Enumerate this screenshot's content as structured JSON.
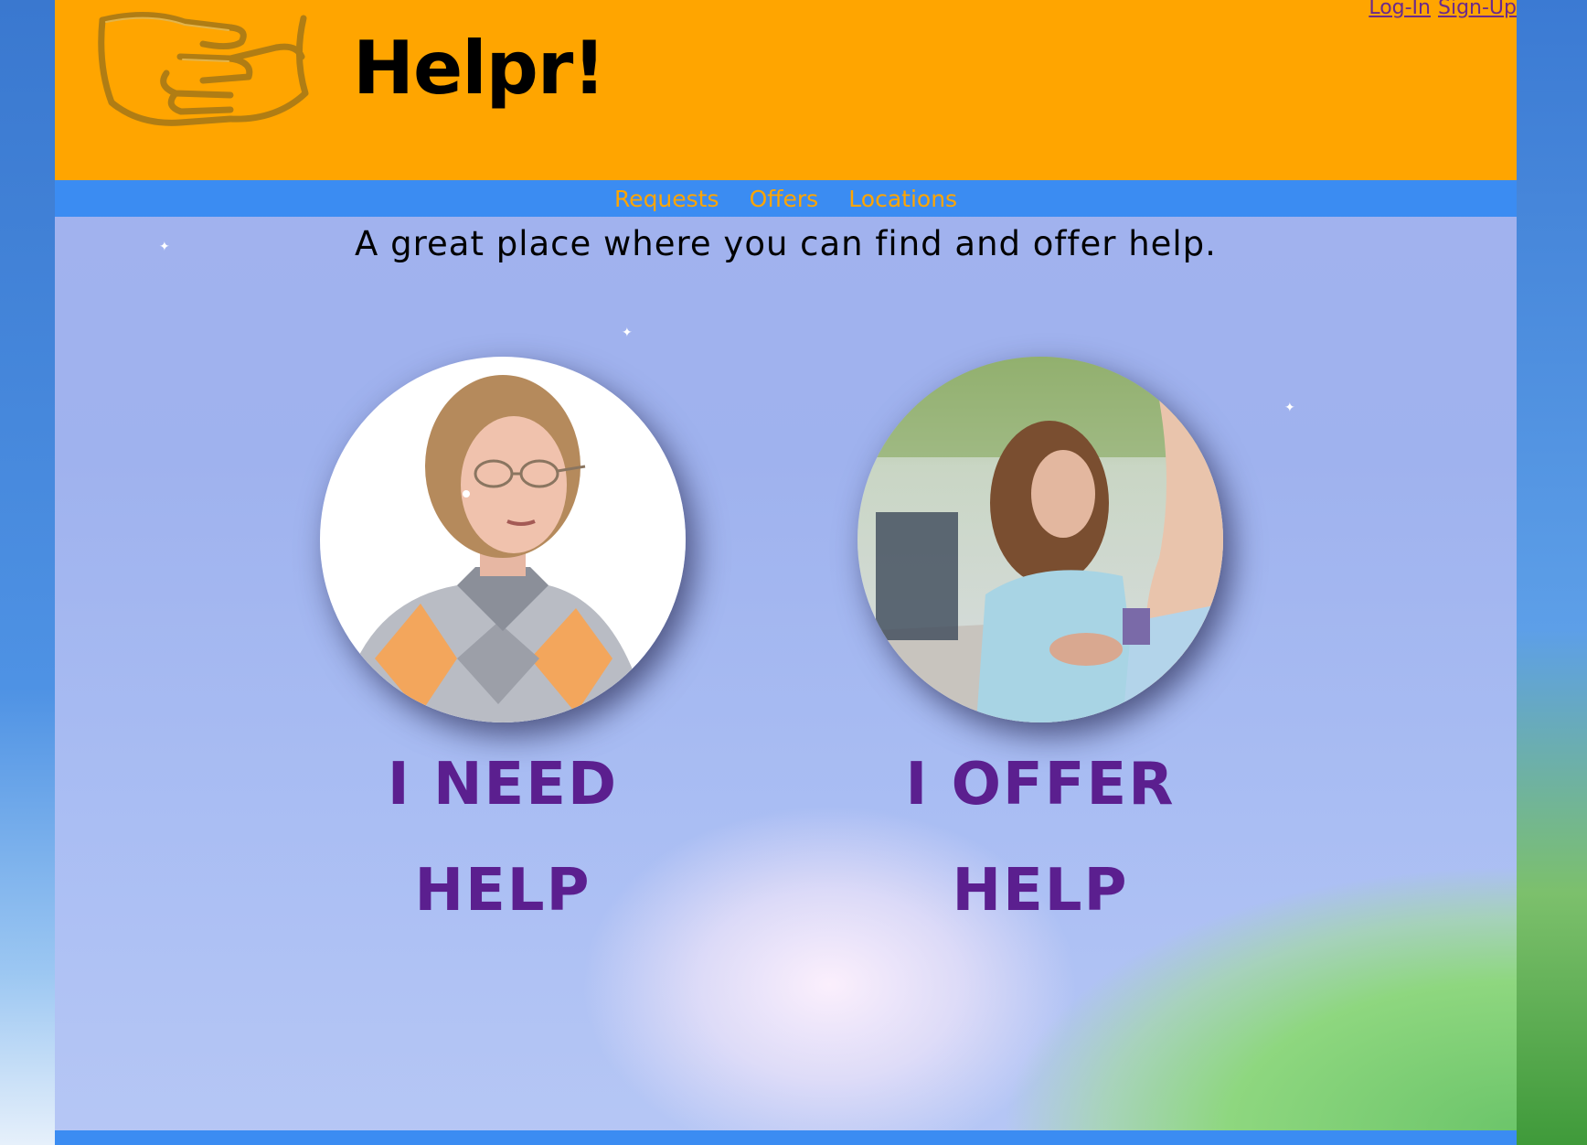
{
  "header": {
    "title": "Helpr!",
    "auth_links": [
      "Log-In",
      "Sign-Up"
    ]
  },
  "nav": {
    "items": [
      "Requests",
      "Offers",
      "Locations"
    ]
  },
  "main": {
    "tagline": "A great place where you can find and offer help.",
    "options": [
      {
        "line1": "I NEED",
        "line2": "HELP"
      },
      {
        "line1": "I OFFER",
        "line2": "HELP"
      }
    ]
  },
  "colors": {
    "header_bg": "#ffa500",
    "nav_bg": "#3b8cf2",
    "nav_link": "#ffa500",
    "option_text": "#5b1f8f",
    "auth_link": "#6b2a8c"
  },
  "icons": [
    "handshake-logo-icon"
  ]
}
